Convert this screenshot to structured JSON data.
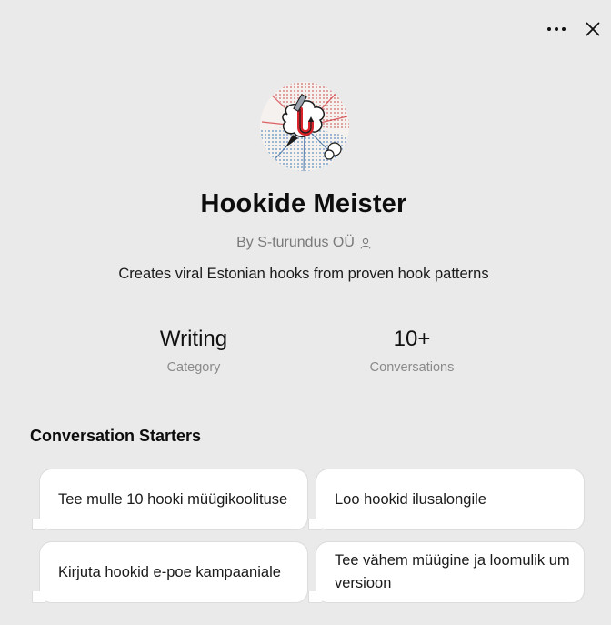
{
  "gpt": {
    "name": "Hookide Meister",
    "byline": "By S-turundus OÜ",
    "description": "Creates viral Estonian hooks from proven hook patterns"
  },
  "stats": {
    "category": {
      "value": "Writing",
      "label": "Category"
    },
    "conversations": {
      "value": "10+",
      "label": "Conversations"
    }
  },
  "starters": {
    "heading": "Conversation Starters",
    "items": [
      "Tee mulle 10 hooki müügikoolituse",
      "Loo hookid ilusalongile",
      "Kirjuta hookid e-poe kampaaniale",
      "Tee vähem müügine ja loomulik um versioon"
    ]
  },
  "icons": {
    "more": "more-horizontal-icon",
    "close": "close-icon",
    "user": "user-icon"
  },
  "colors": {
    "background": "#eaeaea",
    "card": "#ffffff",
    "accent_red": "#d8232a",
    "accent_blue": "#3b7fc4"
  }
}
